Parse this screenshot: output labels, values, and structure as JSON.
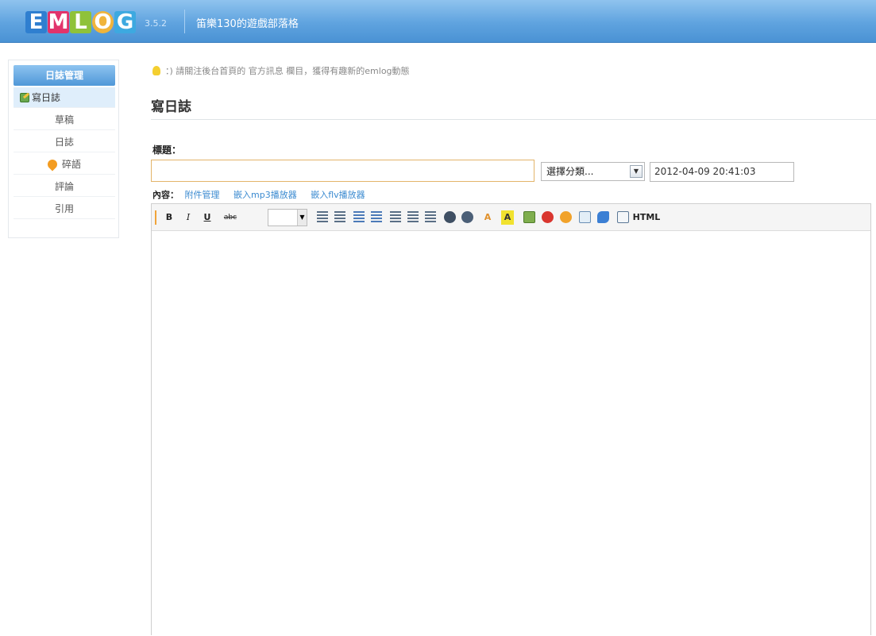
{
  "header": {
    "logo_letters": [
      "E",
      "M",
      "L",
      "O",
      "G"
    ],
    "version": "3.5.2",
    "blog_name": "笛樂130的遊戲部落格"
  },
  "sidebar": {
    "heading": "日誌管理",
    "items": [
      {
        "label": "寫日誌",
        "icon": "edit-icon",
        "active": true
      },
      {
        "label": "草稿",
        "icon": null,
        "active": false
      },
      {
        "label": "日誌",
        "icon": null,
        "active": false
      },
      {
        "label": "碎語",
        "icon": "flame-icon",
        "active": false
      },
      {
        "label": "評論",
        "icon": null,
        "active": false
      },
      {
        "label": "引用",
        "icon": null,
        "active": false
      }
    ]
  },
  "tip": {
    "icon": "bulb-icon",
    "text": "：) 請關注後台首頁的 官方訊息 欄目，獲得有趣新的emlog動態"
  },
  "page": {
    "title": "寫日誌"
  },
  "form": {
    "title_label": "標題：",
    "title_value": "",
    "category_selected": "選擇分類...",
    "date_value": "2012-04-09 20:41:03",
    "content_label": "內容：",
    "content_links": [
      "附件管理",
      "嵌入mp3播放器",
      "嵌入flv播放器"
    ]
  },
  "toolbar": {
    "bold": "B",
    "italic": "I",
    "underline": "U",
    "strike": "abc",
    "font_color": "A",
    "bg_color": "A",
    "html": "HTML"
  },
  "colors": {
    "header_blue": "#5fa3df",
    "link_blue": "#3a8ad0",
    "input_focus": "#e3b46a"
  }
}
